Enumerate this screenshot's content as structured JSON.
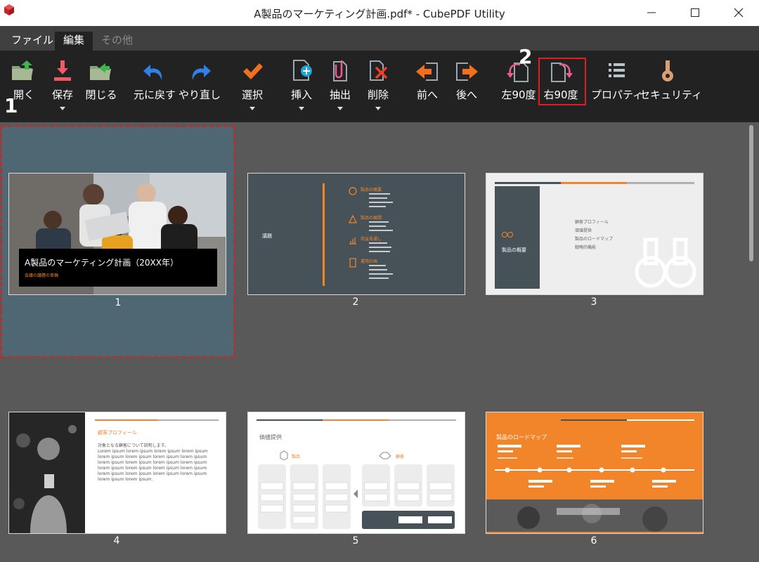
{
  "window": {
    "title": "A製品のマーケティング計画.pdf* - CubePDF Utility"
  },
  "menu": {
    "tabs": [
      {
        "label": "ファイル",
        "state": "normal"
      },
      {
        "label": "編集",
        "state": "active"
      },
      {
        "label": "その他",
        "state": "disabled"
      }
    ]
  },
  "toolbar": {
    "open": "開く",
    "save": "保存",
    "close": "閉じる",
    "undo": "元に戻す",
    "redo": "やり直し",
    "select": "選択",
    "insert": "挿入",
    "extract": "抽出",
    "delete": "削除",
    "prev": "前へ",
    "next": "後へ",
    "rotate_left": "左90度",
    "rotate_right": "右90度",
    "properties": "プロパティ",
    "security": "セキュリティ"
  },
  "annotations": {
    "step1": "1",
    "step2": "2"
  },
  "pages": [
    {
      "number": "1",
      "title": "A製品のマーケティング計画（20XX年）",
      "subtitle": "会議の議題の草稿"
    },
    {
      "number": "2",
      "left_label": "議題",
      "items": [
        "製品の概要",
        "製品の展開",
        "収益見通し",
        "運用計画"
      ]
    },
    {
      "number": "3",
      "left_label": "製品の概要",
      "bullets": [
        "顧客プロフィール",
        "価値提供",
        "製品のロードマップ",
        "戦略的機能"
      ]
    },
    {
      "number": "4",
      "heading": "顧客プロフィール",
      "bullets": [
        "対象となる顧客について説明します。",
        "Lorem ipsum lorem ipsum lorem ipsum lorem ipsum lorem ipsum lorem ipsum lorem ipsum lorem ipsum lorem ipsum lorem ipsum lorem ipsum lorem ipsum lorem ipsum lorem ipsum lorem ipsum lorem ipsum lorem ipsum lorem ipsum lorem ipsum lorem ipsum lorem ipsum lorem ipsum."
      ]
    },
    {
      "number": "5",
      "heading": "価値提供",
      "group_a": "製品",
      "group_b": "顧客"
    },
    {
      "number": "6",
      "heading": "製品のロードマップ"
    }
  ],
  "colors": {
    "accent": "#f2852a",
    "slate": "#465258",
    "selected_bg": "#4f6773",
    "highlight": "#e02020"
  }
}
